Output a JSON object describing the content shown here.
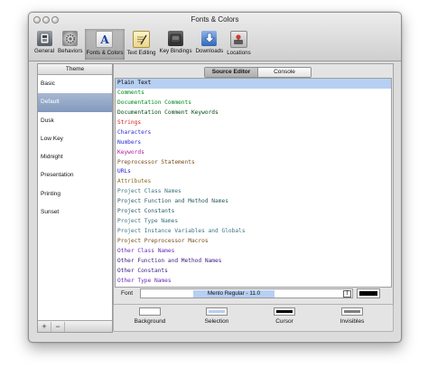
{
  "window": {
    "title": "Fonts & Colors"
  },
  "toolbar": {
    "items": [
      {
        "label": "General",
        "icon": "switch-icon"
      },
      {
        "label": "Behaviors",
        "icon": "gear-icon"
      },
      {
        "label": "Fonts & Colors",
        "icon": "fonts-colors-icon",
        "glyph": "A"
      },
      {
        "label": "Text Editing",
        "icon": "text-editing-icon"
      },
      {
        "label": "Key Bindings",
        "icon": "keyboard-icon"
      },
      {
        "label": "Downloads",
        "icon": "downloads-icon"
      },
      {
        "label": "Locations",
        "icon": "locations-icon"
      }
    ],
    "selected_index": 2
  },
  "themes": {
    "header": "Theme",
    "items": [
      "Basic",
      "Default",
      "Dusk",
      "Low Key",
      "Midnight",
      "Presentation",
      "Printing",
      "Sunset"
    ],
    "selected_index": 1,
    "add_label": "+",
    "remove_label": "−"
  },
  "tabs": {
    "items": [
      "Source Editor",
      "Console"
    ],
    "selected_index": 0
  },
  "syntax": {
    "items": [
      {
        "label": "Plain Text",
        "color": "#000000"
      },
      {
        "label": "Comments",
        "color": "#008a1e"
      },
      {
        "label": "Documentation Comments",
        "color": "#008a1e"
      },
      {
        "label": "Documentation Comment Keywords",
        "color": "#004a10"
      },
      {
        "label": "Strings",
        "color": "#d01a1a"
      },
      {
        "label": "Characters",
        "color": "#2c2cd0"
      },
      {
        "label": "Numbers",
        "color": "#2c2cd0"
      },
      {
        "label": "Keywords",
        "color": "#b0169e"
      },
      {
        "label": "Preprocessor Statements",
        "color": "#7a4c1c"
      },
      {
        "label": "URLs",
        "color": "#1a1ad0"
      },
      {
        "label": "Attributes",
        "color": "#8a6a1a"
      },
      {
        "label": "Project Class Names",
        "color": "#3a7484"
      },
      {
        "label": "Project Function and Method Names",
        "color": "#2a5a64"
      },
      {
        "label": "Project Constants",
        "color": "#2a5a64"
      },
      {
        "label": "Project Type Names",
        "color": "#3a7484"
      },
      {
        "label": "Project Instance Variables and Globals",
        "color": "#3a7484"
      },
      {
        "label": "Project Preprocessor Macros",
        "color": "#7a4c1c"
      },
      {
        "label": "Other Class Names",
        "color": "#6a2ab8"
      },
      {
        "label": "Other Function and Method Names",
        "color": "#3a1a80"
      },
      {
        "label": "Other Constants",
        "color": "#3a1a80"
      },
      {
        "label": "Other Type Names",
        "color": "#6a2ab8"
      }
    ],
    "selected_index": 0
  },
  "font": {
    "label": "Font",
    "value": "Menlo Regular - 11.0",
    "icon": "font-picker-icon",
    "icon_glyph": "T",
    "color": "#000000"
  },
  "wells": [
    {
      "label": "Background",
      "color": "#ffffff"
    },
    {
      "label": "Selection",
      "color": "#b7cff2"
    },
    {
      "label": "Cursor",
      "color": "#000000"
    },
    {
      "label": "Invisibles",
      "color": "#7f7f7f"
    }
  ],
  "colors": {
    "selection_blue": "#b7cff2",
    "sidebar_selection": "#8399bd"
  }
}
